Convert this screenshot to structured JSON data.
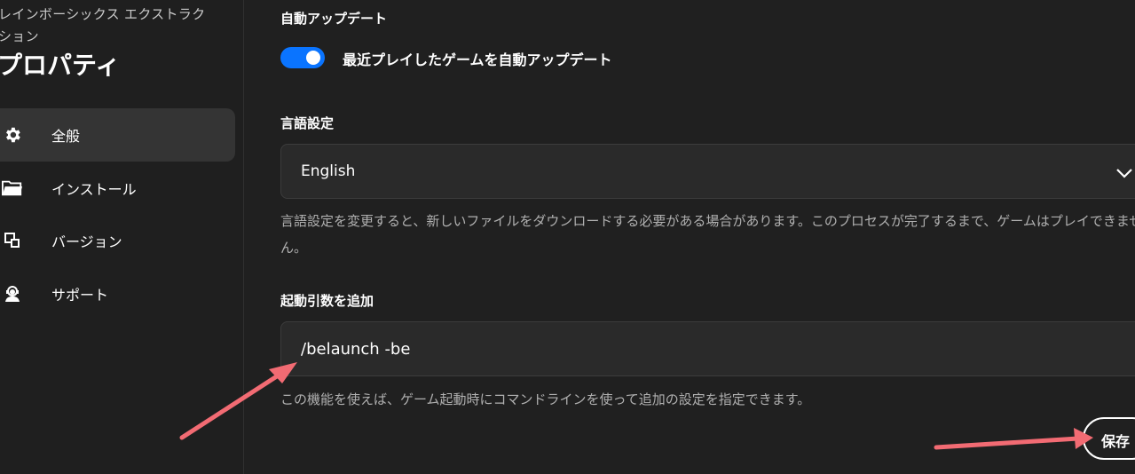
{
  "sidebar": {
    "game_title": "レインボーシックス エクストラクション",
    "heading": "プロパティ",
    "items": [
      {
        "label": "全般",
        "icon": "gear-icon",
        "active": true
      },
      {
        "label": "インストール",
        "icon": "folder-icon",
        "active": false
      },
      {
        "label": "バージョン",
        "icon": "versions-icon",
        "active": false
      },
      {
        "label": "サポート",
        "icon": "support-agent-icon",
        "active": false
      }
    ]
  },
  "main": {
    "auto_update": {
      "heading": "自動アップデート",
      "toggle_label": "最近プレイしたゲームを自動アップデート",
      "enabled": true
    },
    "language": {
      "heading": "言語設定",
      "selected": "English",
      "help": "言語設定を変更すると、新しいファイルをダウンロードする必要がある場合があります。このプロセスが完了するまで、ゲームはプレイできません。"
    },
    "launch_args": {
      "heading": "起動引数を追加",
      "value": "/belaunch -be",
      "help": "この機能を使えば、ゲーム起動時にコマンドラインを使って追加の設定を指定できます。"
    },
    "save_label": "保存"
  },
  "colors": {
    "background": "#202020",
    "accent": "#0a74ff",
    "annotation_arrow": "#f26b73"
  }
}
